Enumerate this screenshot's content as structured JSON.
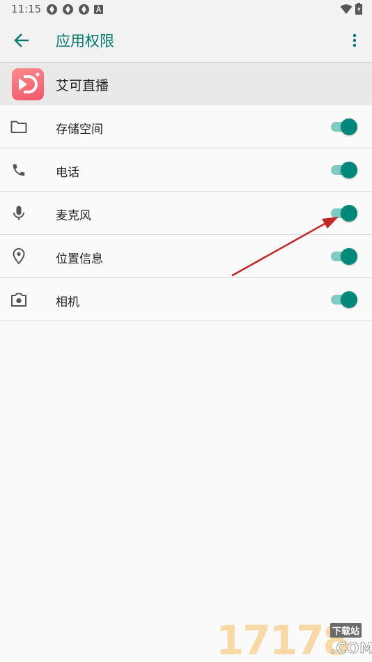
{
  "status_bar": {
    "time": "11:15",
    "left_icons": [
      "sync-icon",
      "sync-icon",
      "sync-icon",
      "a-badge-icon"
    ],
    "right_icons": [
      "wifi-icon",
      "battery-icon"
    ]
  },
  "app_bar": {
    "title": "应用权限",
    "back_icon": "arrow-back-icon",
    "menu_icon": "more-vert-icon",
    "accent": "#00796b"
  },
  "app": {
    "name": "艾可直播",
    "icon": "app-logo-icon"
  },
  "permissions": [
    {
      "label": "存储空间",
      "icon": "folder-icon",
      "enabled": true
    },
    {
      "label": "电话",
      "icon": "phone-icon",
      "enabled": true
    },
    {
      "label": "麦克风",
      "icon": "microphone-icon",
      "enabled": true
    },
    {
      "label": "位置信息",
      "icon": "location-icon",
      "enabled": true
    },
    {
      "label": "相机",
      "icon": "camera-icon",
      "enabled": true
    }
  ],
  "toggle_colors": {
    "thumb": "#00897b",
    "track": "#80cbc4"
  },
  "annotation": {
    "type": "red-arrow",
    "points_to": "麦克风",
    "color": "#d32f2f"
  },
  "watermark": {
    "digits": "17178",
    "badge": "下载站",
    "suffix": ".COM"
  }
}
